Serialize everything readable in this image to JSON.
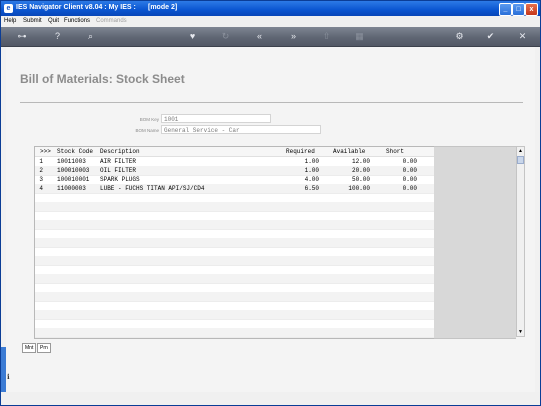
{
  "window": {
    "title": "IES Navigator Client v8.04 : My IES :",
    "mode": "[mode 2]",
    "btn_min": "_",
    "btn_max": "□",
    "btn_close": "x"
  },
  "menu": {
    "items": [
      "Help",
      "Submit",
      "Quit",
      "Functions",
      "Commands"
    ]
  },
  "toolbar": {
    "icons": [
      "key-icon",
      "help-icon",
      "search-icon",
      "heart-icon",
      "refresh-icon",
      "rewind-icon",
      "fast-forward-icon",
      "upload-icon",
      "grid-icon",
      "settings-icon",
      "check-icon",
      "close-icon"
    ]
  },
  "page": {
    "title": "Bill of Materials: Stock Sheet",
    "bom_key_label": "BOM Key",
    "bom_key_value": "1001",
    "bom_name_label": "BOM Name",
    "bom_name_value": "General Service - Car"
  },
  "grid": {
    "headers": {
      "marker": ">>>",
      "stock_code": "Stock Code",
      "description": "Description",
      "required": "Required",
      "available": "Available",
      "short": "Short"
    },
    "rows": [
      {
        "n": "1",
        "stock_code": "10011003",
        "description": "AIR FILTER",
        "required": "1.00",
        "available": "12.00",
        "short": "0.00"
      },
      {
        "n": "2",
        "stock_code": "100010003",
        "description": "OIL FILTER",
        "required": "1.00",
        "available": "20.00",
        "short": "0.00"
      },
      {
        "n": "3",
        "stock_code": "100010001",
        "description": "SPARK PLUGS",
        "required": "4.00",
        "available": "50.00",
        "short": "0.00"
      },
      {
        "n": "4",
        "stock_code": "11000003",
        "description": "LUBE - FUCHS TITAN API/SJ/CD4",
        "required": "6.50",
        "available": "100.00",
        "short": "0.00"
      }
    ]
  },
  "tabs": [
    "Mnt",
    "Prn"
  ],
  "colors": {
    "titlebar": "#0a55d0",
    "toolbar": "#5f6673",
    "page_title": "#8c8c8c"
  }
}
